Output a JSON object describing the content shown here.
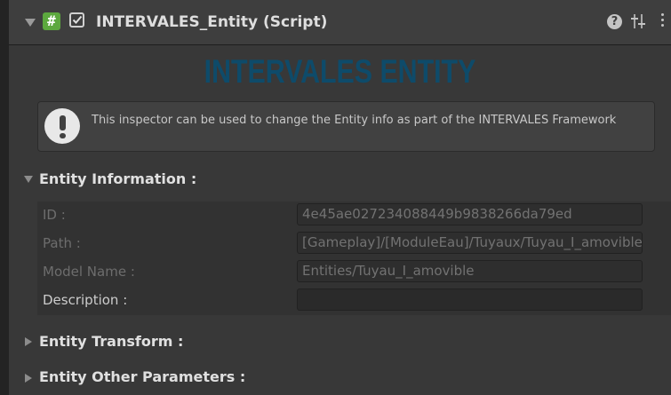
{
  "header": {
    "title": "INTERVALES_Entity (Script)",
    "script_icon_glyph": "#",
    "enabled": true,
    "help_glyph": "?"
  },
  "banner": {
    "title": "INTERVALES ENTITY",
    "color": "#0e4b6a"
  },
  "helpbox": {
    "icon": "info-icon",
    "text": "This inspector can be used to change the Entity info as part of the INTERVALES Framework"
  },
  "sections": {
    "information": {
      "label": "Entity Information :",
      "expanded": true,
      "fields": [
        {
          "label": "ID :",
          "value": "4e45ae027234088449b9838266da79ed",
          "editable": false
        },
        {
          "label": "Path :",
          "value": "[Gameplay]/[ModuleEau]/Tuyaux/Tuyau_I_amovible",
          "editable": false
        },
        {
          "label": "Model Name :",
          "value": "Entities/Tuyau_I_amovible",
          "editable": false
        },
        {
          "label": "Description :",
          "value": "",
          "editable": true
        }
      ]
    },
    "transform": {
      "label": "Entity Transform :",
      "expanded": false
    },
    "other": {
      "label": "Entity Other Parameters :",
      "expanded": false
    }
  }
}
